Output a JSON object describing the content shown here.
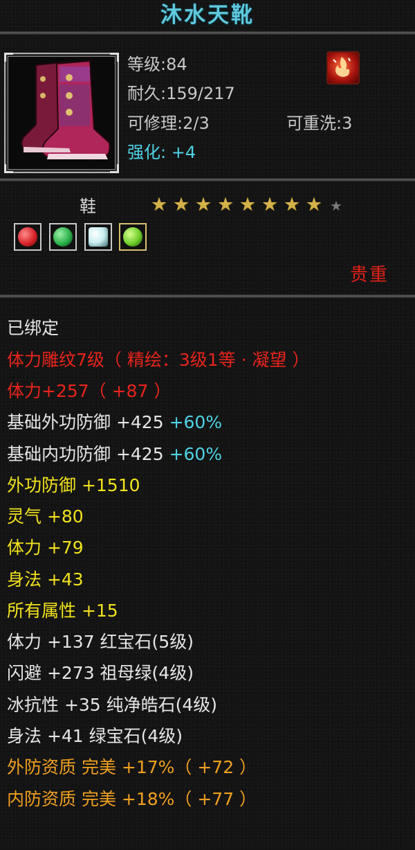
{
  "item": {
    "name": "沐水天靴",
    "level_text": "等级:84",
    "durability_text": "耐久:159/217",
    "repair_text": "可修理:2/3",
    "rewash_text": "可重洗:3",
    "enhance_label": "强化:",
    "enhance_value": "+4",
    "type": "鞋",
    "stars_total": 9,
    "stars_filled": 8,
    "rarity": "贵重",
    "gems": [
      {
        "icon": "red-gem-icon",
        "color": "#d8242a"
      },
      {
        "icon": "green-gem-icon",
        "color": "#2bb04a"
      },
      {
        "icon": "white-gem-icon",
        "color": "#c8eef0"
      },
      {
        "icon": "green-gem-icon",
        "color": "#6fcc2a"
      }
    ]
  },
  "stats": {
    "bound": "已绑定",
    "engrave": "体力雕纹7级（ 精绘：3级1等 · 凝望 ）",
    "stamina_engrave": "体力+257（ +87 ）",
    "base_ext_def": "基础外功防御 +425",
    "base_ext_def_pct": "+60%",
    "base_int_def": "基础内功防御 +425",
    "base_int_def_pct": "+60%",
    "ext_def": "外功防御 +1510",
    "spirit": "灵气 +80",
    "stamina": "体力 +79",
    "agility": "身法 +43",
    "all_attr": "所有属性 +15",
    "gem_stamina": "体力 +137 红宝石(5级)",
    "gem_dodge": "闪避 +273 祖母绿(4级)",
    "gem_ice": "冰抗性 +35 纯净皓石(4级)",
    "gem_agility": "身法 +41 绿宝石(4级)",
    "ext_quality": "外防资质  完美 +17%（ +72 ）",
    "int_quality": "内防资质  完美 +18%（ +77 ）"
  },
  "colors": {
    "title": "#5fc8dc",
    "white": "#e6e6e6",
    "red": "#e8241c",
    "yellow": "#f2e21e",
    "cyan": "#4fd2e6",
    "orange": "#f0a020"
  }
}
